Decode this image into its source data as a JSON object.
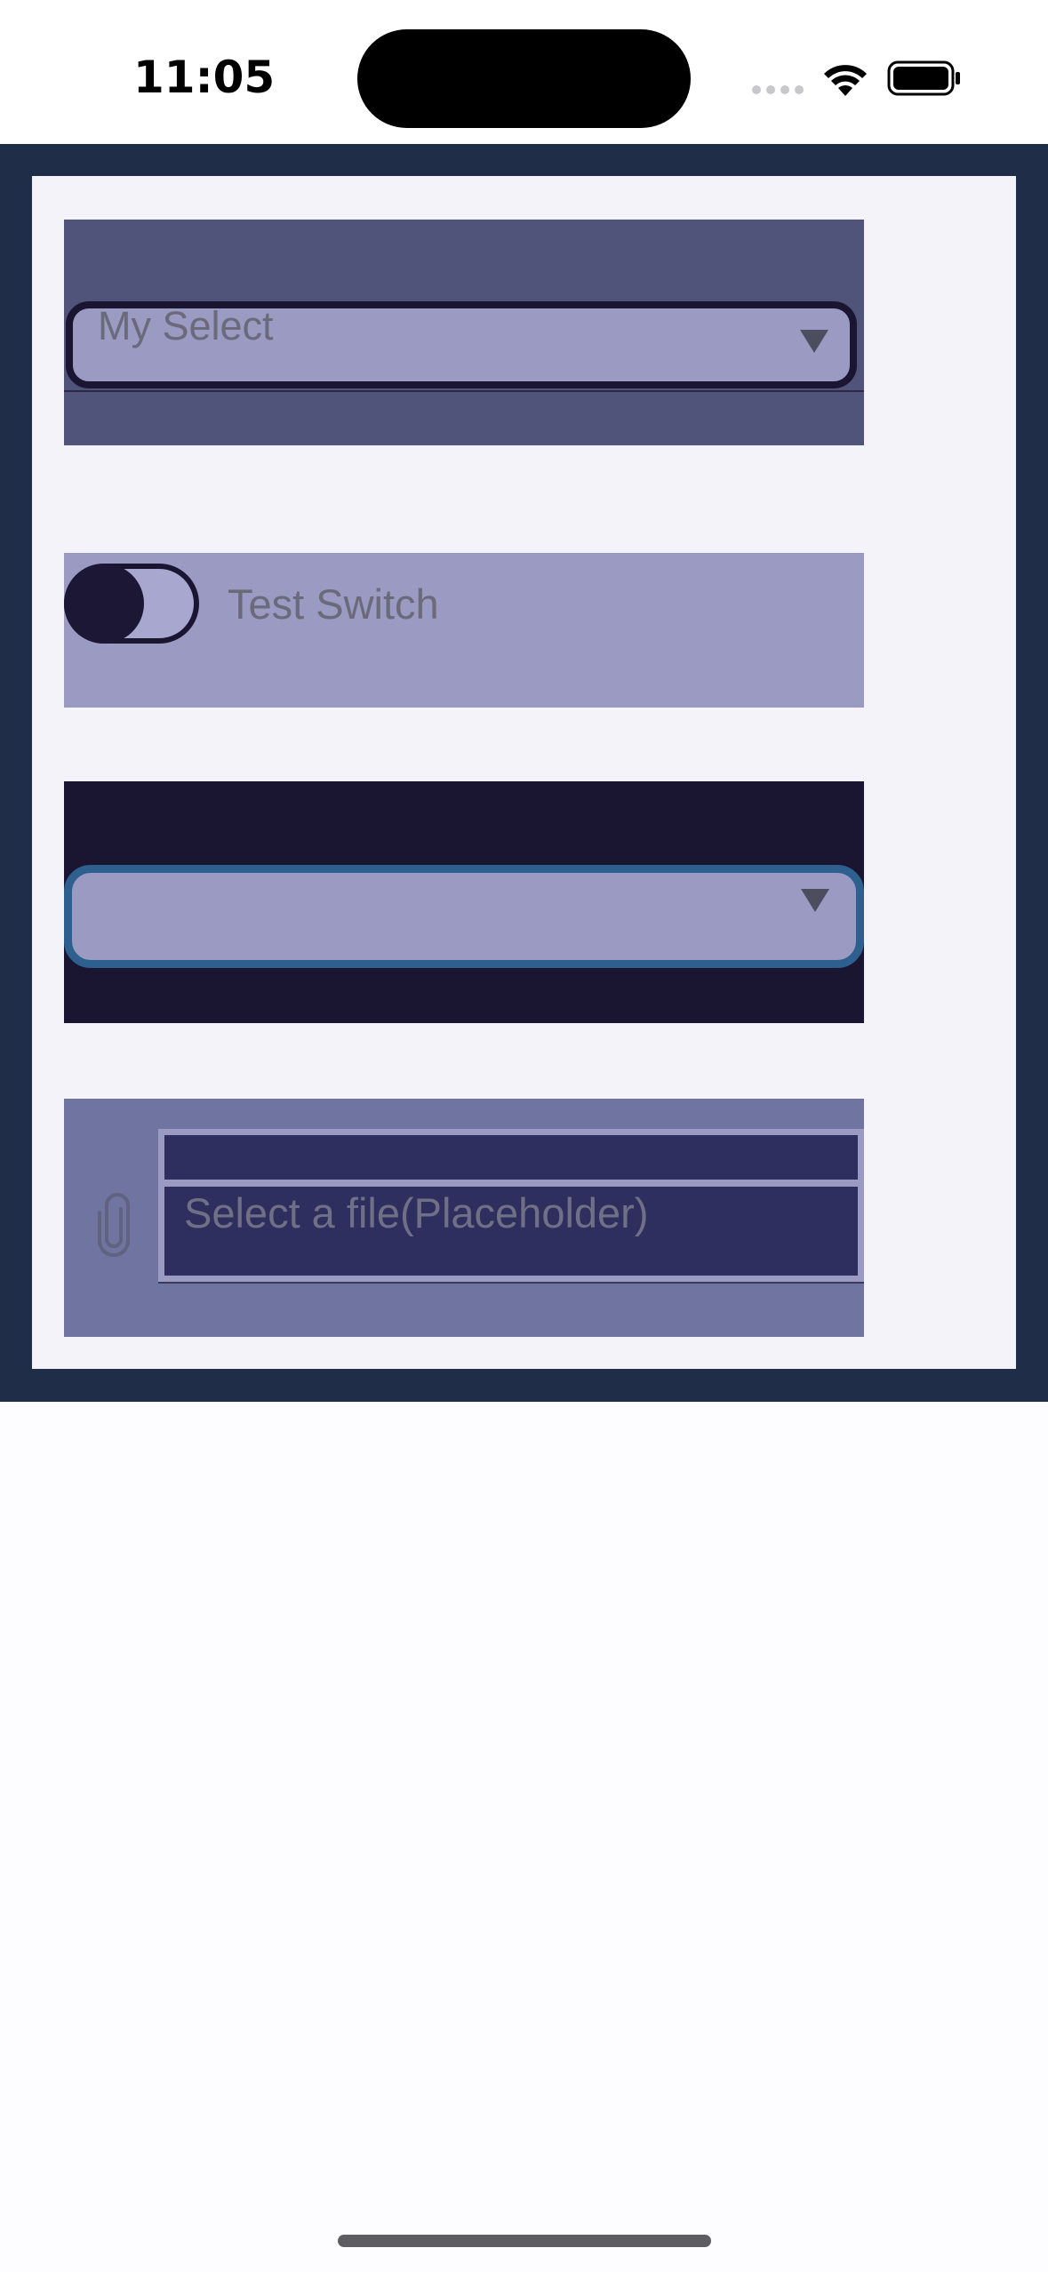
{
  "status_bar": {
    "time": "11:05",
    "wifi_icon": "wifi-icon",
    "battery_icon": "battery-icon"
  },
  "form": {
    "select_1": {
      "label": "My Select",
      "value": "",
      "caret_icon": "triangle-down-icon"
    },
    "switch": {
      "label": "Test Switch",
      "checked": false
    },
    "select_2": {
      "label": "",
      "value": "",
      "caret_icon": "triangle-down-icon"
    },
    "file_input": {
      "placeholder": "Select a file(Placeholder)",
      "icon": "paperclip-icon"
    }
  },
  "colors": {
    "frame": "#1f2d48",
    "panel": "#f4f3f9",
    "accent_light": "#9a9ac3",
    "accent_dark": "#1a1530",
    "focus_border": "#2d5f8f"
  }
}
